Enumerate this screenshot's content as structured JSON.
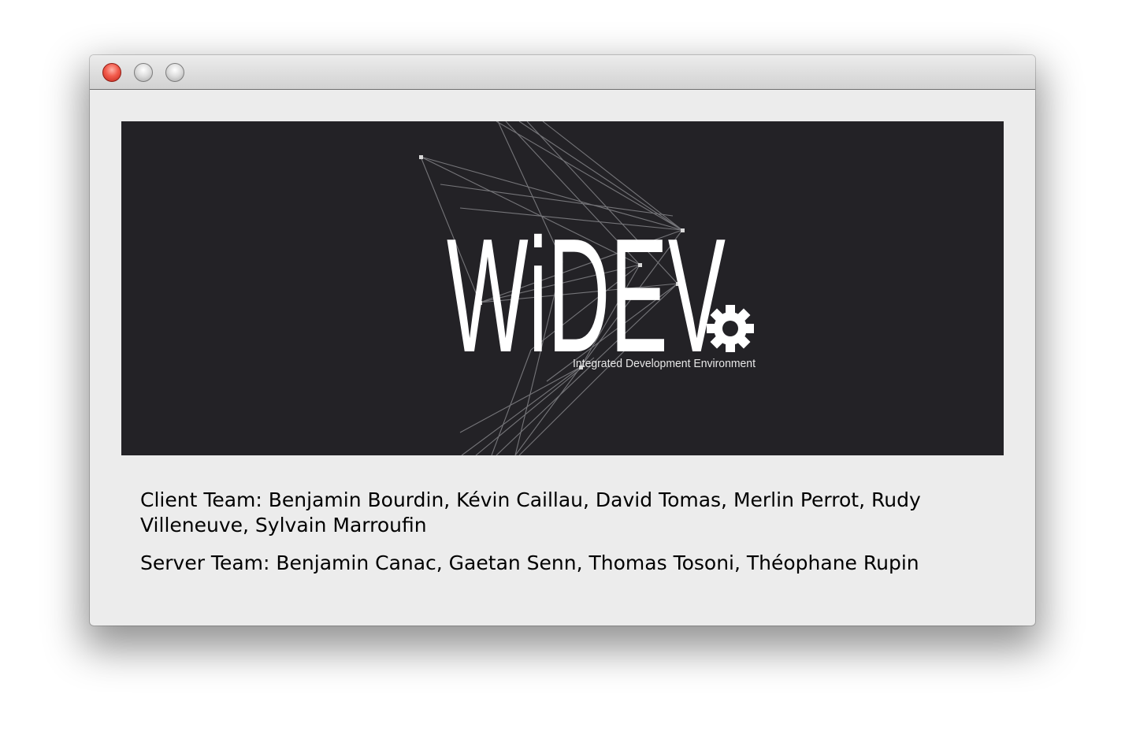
{
  "window": {
    "controls": {
      "close_icon": "close-icon",
      "minimize_icon": "minimize-icon",
      "zoom_icon": "zoom-icon"
    }
  },
  "banner": {
    "logo_text": "WiDEV",
    "tagline": "Integrated Development Environment",
    "background_color": "#232226",
    "logo_color": "#ffffff"
  },
  "credits": {
    "client_team": "Client Team: Benjamin Bourdin, Kévin Caillau, David Tomas, Merlin Perrot, Rudy Villeneuve, Sylvain Marroufin",
    "server_team": "Server Team: Benjamin Canac, Gaetan Senn, Thomas Tosoni, Théophane Rupin"
  }
}
